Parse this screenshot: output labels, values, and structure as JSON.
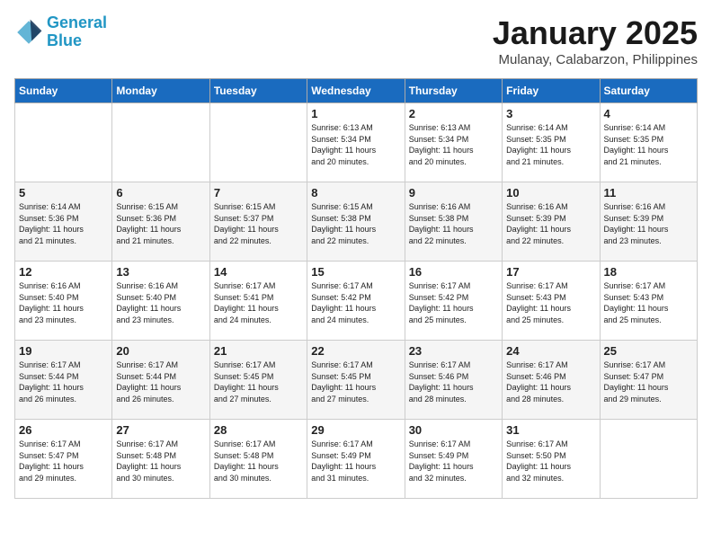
{
  "header": {
    "logo_line1": "General",
    "logo_line2": "Blue",
    "month": "January 2025",
    "location": "Mulanay, Calabarzon, Philippines"
  },
  "days_of_week": [
    "Sunday",
    "Monday",
    "Tuesday",
    "Wednesday",
    "Thursday",
    "Friday",
    "Saturday"
  ],
  "weeks": [
    [
      {
        "day": "",
        "info": ""
      },
      {
        "day": "",
        "info": ""
      },
      {
        "day": "",
        "info": ""
      },
      {
        "day": "1",
        "info": "Sunrise: 6:13 AM\nSunset: 5:34 PM\nDaylight: 11 hours\nand 20 minutes."
      },
      {
        "day": "2",
        "info": "Sunrise: 6:13 AM\nSunset: 5:34 PM\nDaylight: 11 hours\nand 20 minutes."
      },
      {
        "day": "3",
        "info": "Sunrise: 6:14 AM\nSunset: 5:35 PM\nDaylight: 11 hours\nand 21 minutes."
      },
      {
        "day": "4",
        "info": "Sunrise: 6:14 AM\nSunset: 5:35 PM\nDaylight: 11 hours\nand 21 minutes."
      }
    ],
    [
      {
        "day": "5",
        "info": "Sunrise: 6:14 AM\nSunset: 5:36 PM\nDaylight: 11 hours\nand 21 minutes."
      },
      {
        "day": "6",
        "info": "Sunrise: 6:15 AM\nSunset: 5:36 PM\nDaylight: 11 hours\nand 21 minutes."
      },
      {
        "day": "7",
        "info": "Sunrise: 6:15 AM\nSunset: 5:37 PM\nDaylight: 11 hours\nand 22 minutes."
      },
      {
        "day": "8",
        "info": "Sunrise: 6:15 AM\nSunset: 5:38 PM\nDaylight: 11 hours\nand 22 minutes."
      },
      {
        "day": "9",
        "info": "Sunrise: 6:16 AM\nSunset: 5:38 PM\nDaylight: 11 hours\nand 22 minutes."
      },
      {
        "day": "10",
        "info": "Sunrise: 6:16 AM\nSunset: 5:39 PM\nDaylight: 11 hours\nand 22 minutes."
      },
      {
        "day": "11",
        "info": "Sunrise: 6:16 AM\nSunset: 5:39 PM\nDaylight: 11 hours\nand 23 minutes."
      }
    ],
    [
      {
        "day": "12",
        "info": "Sunrise: 6:16 AM\nSunset: 5:40 PM\nDaylight: 11 hours\nand 23 minutes."
      },
      {
        "day": "13",
        "info": "Sunrise: 6:16 AM\nSunset: 5:40 PM\nDaylight: 11 hours\nand 23 minutes."
      },
      {
        "day": "14",
        "info": "Sunrise: 6:17 AM\nSunset: 5:41 PM\nDaylight: 11 hours\nand 24 minutes."
      },
      {
        "day": "15",
        "info": "Sunrise: 6:17 AM\nSunset: 5:42 PM\nDaylight: 11 hours\nand 24 minutes."
      },
      {
        "day": "16",
        "info": "Sunrise: 6:17 AM\nSunset: 5:42 PM\nDaylight: 11 hours\nand 25 minutes."
      },
      {
        "day": "17",
        "info": "Sunrise: 6:17 AM\nSunset: 5:43 PM\nDaylight: 11 hours\nand 25 minutes."
      },
      {
        "day": "18",
        "info": "Sunrise: 6:17 AM\nSunset: 5:43 PM\nDaylight: 11 hours\nand 25 minutes."
      }
    ],
    [
      {
        "day": "19",
        "info": "Sunrise: 6:17 AM\nSunset: 5:44 PM\nDaylight: 11 hours\nand 26 minutes."
      },
      {
        "day": "20",
        "info": "Sunrise: 6:17 AM\nSunset: 5:44 PM\nDaylight: 11 hours\nand 26 minutes."
      },
      {
        "day": "21",
        "info": "Sunrise: 6:17 AM\nSunset: 5:45 PM\nDaylight: 11 hours\nand 27 minutes."
      },
      {
        "day": "22",
        "info": "Sunrise: 6:17 AM\nSunset: 5:45 PM\nDaylight: 11 hours\nand 27 minutes."
      },
      {
        "day": "23",
        "info": "Sunrise: 6:17 AM\nSunset: 5:46 PM\nDaylight: 11 hours\nand 28 minutes."
      },
      {
        "day": "24",
        "info": "Sunrise: 6:17 AM\nSunset: 5:46 PM\nDaylight: 11 hours\nand 28 minutes."
      },
      {
        "day": "25",
        "info": "Sunrise: 6:17 AM\nSunset: 5:47 PM\nDaylight: 11 hours\nand 29 minutes."
      }
    ],
    [
      {
        "day": "26",
        "info": "Sunrise: 6:17 AM\nSunset: 5:47 PM\nDaylight: 11 hours\nand 29 minutes."
      },
      {
        "day": "27",
        "info": "Sunrise: 6:17 AM\nSunset: 5:48 PM\nDaylight: 11 hours\nand 30 minutes."
      },
      {
        "day": "28",
        "info": "Sunrise: 6:17 AM\nSunset: 5:48 PM\nDaylight: 11 hours\nand 30 minutes."
      },
      {
        "day": "29",
        "info": "Sunrise: 6:17 AM\nSunset: 5:49 PM\nDaylight: 11 hours\nand 31 minutes."
      },
      {
        "day": "30",
        "info": "Sunrise: 6:17 AM\nSunset: 5:49 PM\nDaylight: 11 hours\nand 32 minutes."
      },
      {
        "day": "31",
        "info": "Sunrise: 6:17 AM\nSunset: 5:50 PM\nDaylight: 11 hours\nand 32 minutes."
      },
      {
        "day": "",
        "info": ""
      }
    ]
  ]
}
